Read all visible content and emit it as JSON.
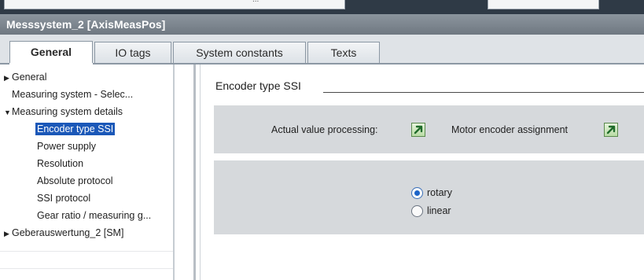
{
  "window": {
    "title": "Messsystem_2 [AxisMeasPos]"
  },
  "tabs": [
    {
      "label": "General",
      "active": true
    },
    {
      "label": "IO tags",
      "active": false
    },
    {
      "label": "System constants",
      "active": false
    },
    {
      "label": "Texts",
      "active": false
    }
  ],
  "tree": [
    {
      "label": "General",
      "expander": "collapsed"
    },
    {
      "label": "Measuring system - Selec...",
      "expander": "none"
    },
    {
      "label": "Measuring system details",
      "expander": "expanded"
    },
    {
      "label": "Encoder type SSI",
      "expander": "none",
      "selected": true
    },
    {
      "label": "Power supply",
      "expander": "none"
    },
    {
      "label": "Resolution",
      "expander": "none"
    },
    {
      "label": "Absolute protocol",
      "expander": "none"
    },
    {
      "label": "SSI protocol",
      "expander": "none"
    },
    {
      "label": "Gear ratio / measuring g...",
      "expander": "none"
    },
    {
      "label": "Geberauswertung_2 [SM]",
      "expander": "collapsed"
    }
  ],
  "content": {
    "section_title": "Encoder type SSI",
    "actual_value_processing_label": "Actual value processing:",
    "motor_encoder_assignment_label": "Motor encoder assignment",
    "radio_options": [
      {
        "label": "rotary",
        "checked": true
      },
      {
        "label": "linear",
        "checked": false
      }
    ]
  },
  "colors": {
    "selection": "#1b58b8",
    "title_bar": "#7d868f",
    "panel_gray": "#d6d9dc",
    "nav_button": "#b9dca5"
  },
  "icons": {
    "navigate": "arrow-up-right-icon",
    "expand": "triangle-right-icon",
    "collapse": "triangle-down-icon"
  }
}
